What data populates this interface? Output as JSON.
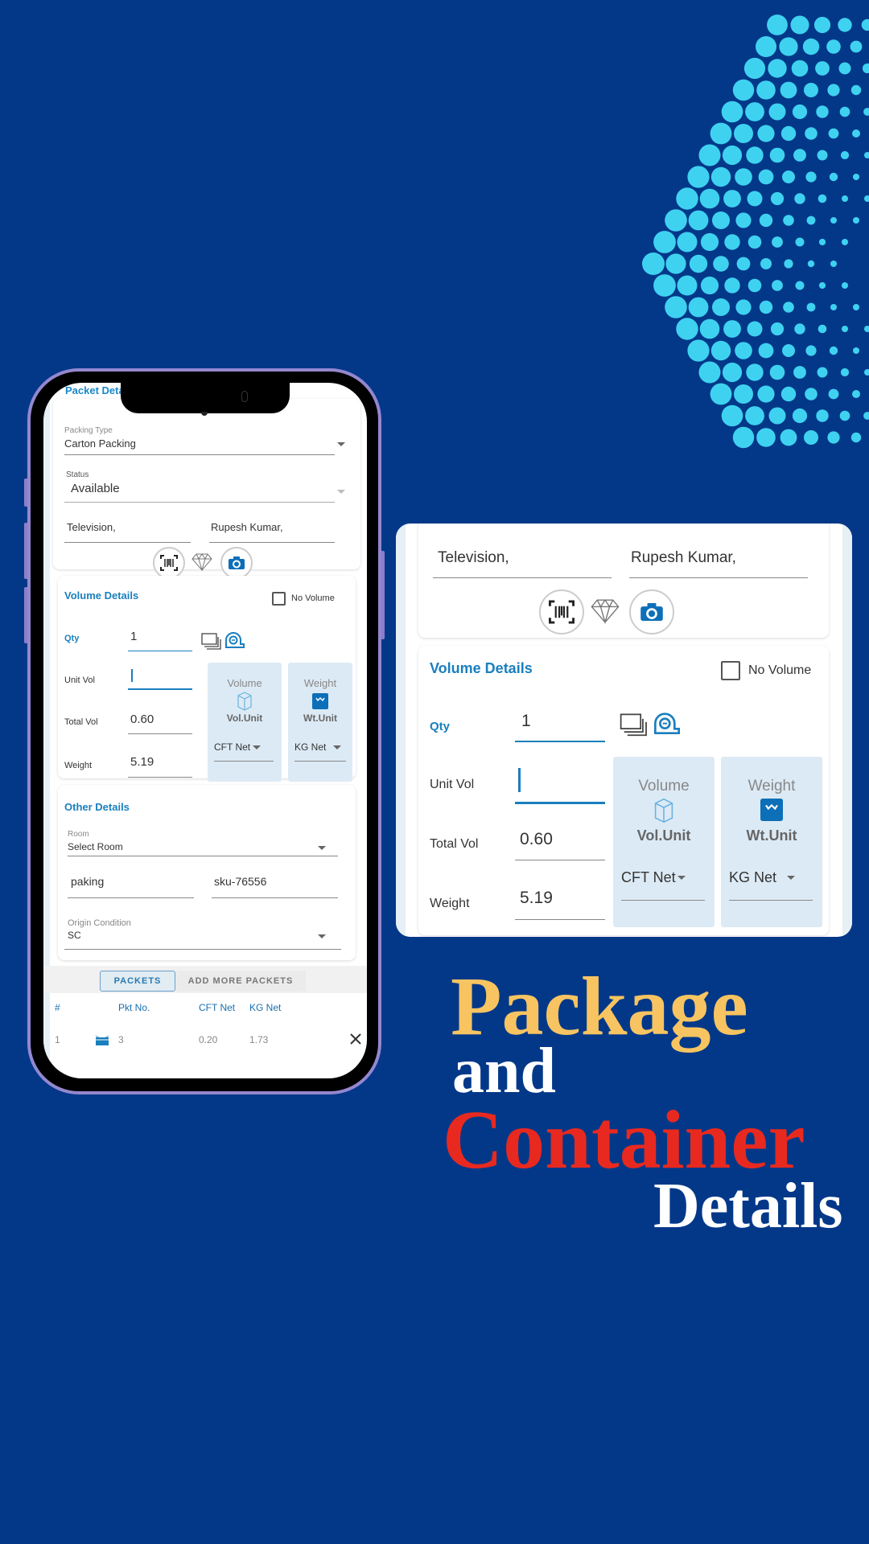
{
  "colors": {
    "background": "#033889",
    "dots": "#3fd2f0",
    "accent": "#1a7fbe",
    "headline_package": "#f7c461",
    "headline_container": "#e8291f",
    "headline_white": "#ffffff"
  },
  "phone": {
    "title": "Packet Details",
    "packet_section": {
      "packing_type_label": "Packing Type",
      "packing_type_value": "Carton Packing",
      "status_label": "Status",
      "status_value": "Available",
      "item_value": "Television,",
      "customer_value": "Rupesh Kumar,",
      "icons": [
        "barcode-scan-icon",
        "diamond-icon",
        "camera-icon"
      ]
    },
    "volume_section": {
      "title": "Volume Details",
      "no_volume_label": "No Volume",
      "no_volume_checked": false,
      "qty_label": "Qty",
      "qty_value": "1",
      "unit_vol_label": "Unit Vol",
      "unit_vol_value": "",
      "total_vol_label": "Total Vol",
      "total_vol_value": "0.60",
      "weight_label": "Weight",
      "weight_value": "5.19",
      "volume_box": {
        "title": "Volume",
        "unit_label": "Vol.Unit",
        "selected": "CFT Net"
      },
      "weight_box": {
        "title": "Weight",
        "unit_label": "Wt.Unit",
        "selected": "KG Net"
      }
    },
    "other_section": {
      "title": "Other Details",
      "room_label": "Room",
      "room_value": "Select Room",
      "remark_value": "paking",
      "sku_value": "sku-76556",
      "origin_label": "Origin Condition",
      "origin_value": "SC"
    },
    "tabs": [
      {
        "label": "PACKETS",
        "active": true
      },
      {
        "label": "ADD MORE PACKETS",
        "active": false
      }
    ],
    "table": {
      "headers": [
        "#",
        "Pkt No.",
        "CFT Net",
        "KG Net"
      ],
      "rows": [
        {
          "index": "1",
          "pkt_no": "3",
          "cft_net": "0.20",
          "kg_net": "1.73"
        }
      ]
    }
  },
  "panel": {
    "item_value": "Television,",
    "customer_value": "Rupesh Kumar,",
    "volume_title": "Volume Details",
    "no_volume_label": "No Volume",
    "qty_label": "Qty",
    "qty_value": "1",
    "unit_vol_label": "Unit Vol",
    "unit_vol_value": "",
    "total_vol_label": "Total Vol",
    "total_vol_value": "0.60",
    "weight_label": "Weight",
    "weight_value": "5.19",
    "volume_box": {
      "title": "Volume",
      "unit_label": "Vol.Unit",
      "selected": "CFT Net"
    },
    "weight_box": {
      "title": "Weight",
      "unit_label": "Wt.Unit",
      "selected": "KG Net"
    }
  },
  "headline": {
    "line1": "Package",
    "line2": "and",
    "line3": "Container",
    "line4": "Details"
  }
}
